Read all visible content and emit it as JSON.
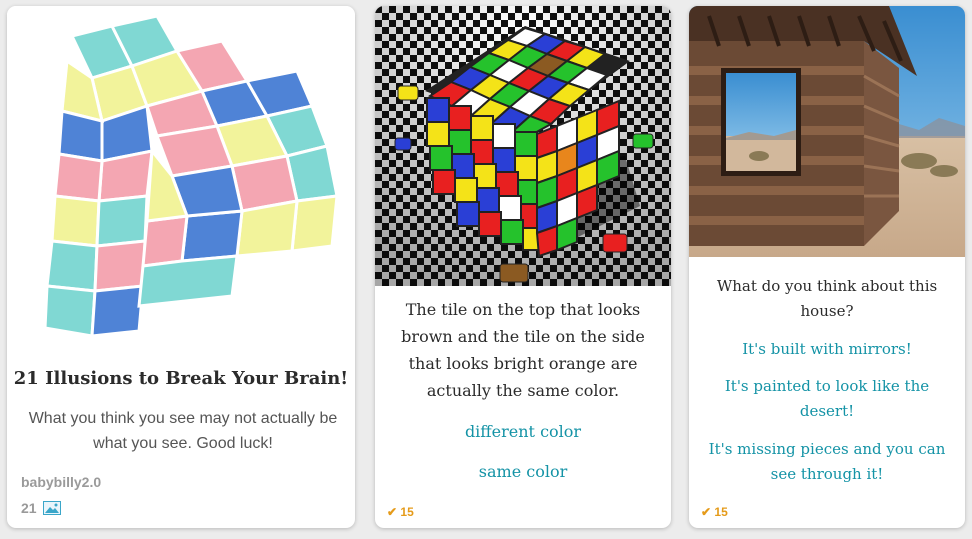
{
  "cards": [
    {
      "image_alt": "impossible triangle illusion",
      "title": "21 Illusions to Break Your Brain!",
      "description": "What you think you see may not actually be what you see. Good luck!",
      "author": "babybilly2.0",
      "item_count": "21",
      "icon": "image-icon"
    },
    {
      "image_alt": "colored cube on checkerboard",
      "question": "The tile on the top that looks brown and the tile on the side that looks bright orange are actually the same color.",
      "answers": [
        "different color",
        "same color"
      ],
      "votes": "15",
      "vote_icon": "check-icon"
    },
    {
      "image_alt": "mirrored house in desert",
      "question": "What do you think about this house?",
      "answers": [
        "It's built with mirrors!",
        "It's painted to look like the desert!",
        "It's missing pieces and you can see through it!"
      ],
      "votes": "15",
      "vote_icon": "check-icon"
    }
  ],
  "colors": {
    "answer_link": "#1493a6",
    "vote_accent": "#e59b1a"
  }
}
